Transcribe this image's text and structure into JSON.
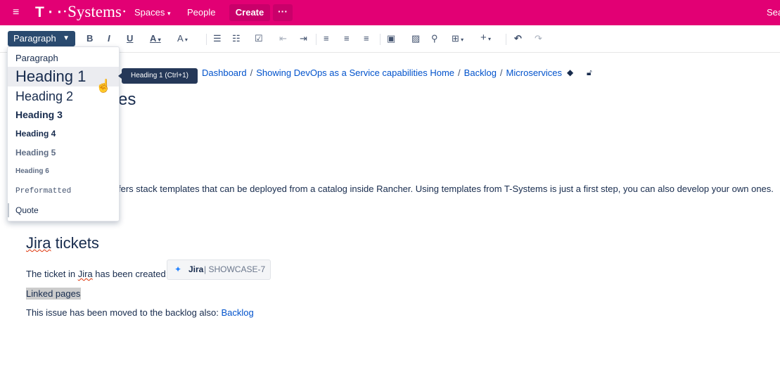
{
  "header": {
    "brand": "·Systems·",
    "brand_t": "T · ·",
    "spaces_label": "Spaces",
    "people_label": "People",
    "create_label": "Create",
    "more_label": "···",
    "search_partial": "Sea",
    "menu_icon": "hamburger-icon",
    "bg_color": "#e20074"
  },
  "toolbar": {
    "paragraph_label": "Paragraph",
    "bold": "B",
    "italic": "I",
    "underline": "U",
    "text_color": "A",
    "more_format": "A",
    "undo": "↶",
    "redo": "↷"
  },
  "dropdown": {
    "items": [
      {
        "label": "Paragraph"
      },
      {
        "label": "Heading 1"
      },
      {
        "label": "Heading 2"
      },
      {
        "label": "Heading 3"
      },
      {
        "label": "Heading 4"
      },
      {
        "label": "Heading 5"
      },
      {
        "label": "Heading 6"
      },
      {
        "label": "Preformatted"
      },
      {
        "label": "Quote"
      }
    ]
  },
  "tooltip": "Heading 1 (Ctrl+1)",
  "breadcrumb": {
    "items": [
      "Dashboard",
      "Showing DevOps as a Service capabilities Home",
      "Backlog",
      "Microservices"
    ],
    "separator": "/"
  },
  "page": {
    "title_fragment": "es",
    "intro_text": "fers stack templates that can be deployed from a catalog inside Rancher. Using templates from T-Systems is just a first step, you can also develop your own ones.",
    "jira_heading_word": "Jira",
    "jira_heading_rest": " tickets",
    "ticket_prefix": "The ticket in ",
    "ticket_jira_word": "Jira",
    "ticket_suffix": " has been created:",
    "jira_chip_label": "Jira",
    "jira_chip_key": "| SHOWCASE-7",
    "linked_pages": "Linked pages",
    "moved_text": "This issue has been moved to the backlog also: ",
    "moved_link": "Backlog"
  }
}
